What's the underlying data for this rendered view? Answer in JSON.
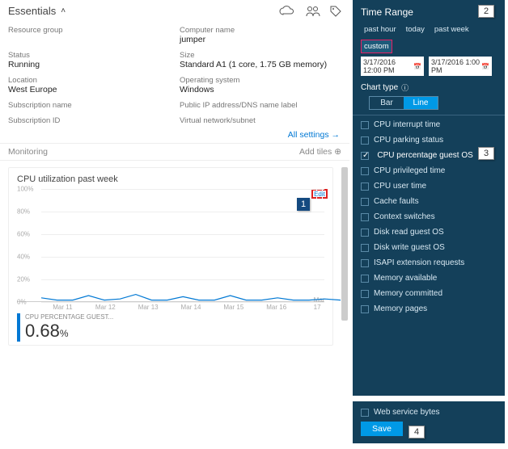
{
  "header": {
    "title": "Essentials"
  },
  "props": {
    "resource_group_lbl": "Resource group",
    "resource_group_val": " ",
    "computer_name_lbl": "Computer name",
    "computer_name_val": "jumper",
    "status_lbl": "Status",
    "status_val": "Running",
    "size_lbl": "Size",
    "size_val": "Standard A1 (1 core, 1.75 GB memory)",
    "location_lbl": "Location",
    "location_val": "West Europe",
    "os_lbl": "Operating system",
    "os_val": "Windows",
    "sub_name_lbl": "Subscription name",
    "sub_name_val": " ",
    "ip_lbl": "Public IP address/DNS name label",
    "ip_val": " ",
    "sub_id_lbl": "Subscription ID",
    "sub_id_val": " ",
    "vnet_lbl": "Virtual network/subnet",
    "vnet_val": " "
  },
  "all_settings": "All settings →",
  "monitoring": {
    "title": "Monitoring",
    "add_tiles": "Add tiles ⊕"
  },
  "chart": {
    "title": "CPU utilization past week",
    "edit": "Edit",
    "kpi_lbl": "CPU PERCENTAGE GUEST...",
    "kpi_val": "0.68",
    "kpi_unit": "%"
  },
  "chart_data": {
    "type": "line",
    "title": "CPU utilization past week",
    "xlabel": "",
    "ylabel": "",
    "ylim": [
      0,
      100
    ],
    "y_ticks": [
      0,
      20,
      40,
      60,
      80,
      100
    ],
    "categories": [
      "Mar 11",
      "Mar 12",
      "Mar 13",
      "Mar 14",
      "Mar 15",
      "Mar 16",
      "Mar 17"
    ],
    "series": [
      {
        "name": "CPU percentage guest OS",
        "values": [
          3,
          1,
          1,
          5,
          1,
          2,
          6,
          1,
          1,
          4,
          1,
          1,
          5,
          1,
          1,
          3,
          1,
          1,
          2,
          1
        ]
      }
    ]
  },
  "right": {
    "title": "Time Range",
    "ranges": {
      "past_hour": "past hour",
      "today": "today",
      "past_week": "past week",
      "custom": "custom"
    },
    "start": "3/17/2016 12:00 PM",
    "end": "3/17/2016 1:00 PM",
    "chart_type_lbl": "Chart type",
    "ct_bar": "Bar",
    "ct_line": "Line",
    "metrics": [
      "CPU interrupt time",
      "CPU parking status",
      "CPU percentage guest OS",
      "CPU privileged time",
      "CPU user time",
      "Cache faults",
      "Context switches",
      "Disk read guest OS",
      "Disk write guest OS",
      "ISAPI extension requests",
      "Memory available",
      "Memory committed",
      "Memory pages"
    ],
    "selected_metric_index": 2
  },
  "bottom": {
    "metric": "Web service bytes",
    "save": "Save"
  },
  "callouts": {
    "c1": "1",
    "c2": "2",
    "c3": "3",
    "c4": "4"
  }
}
